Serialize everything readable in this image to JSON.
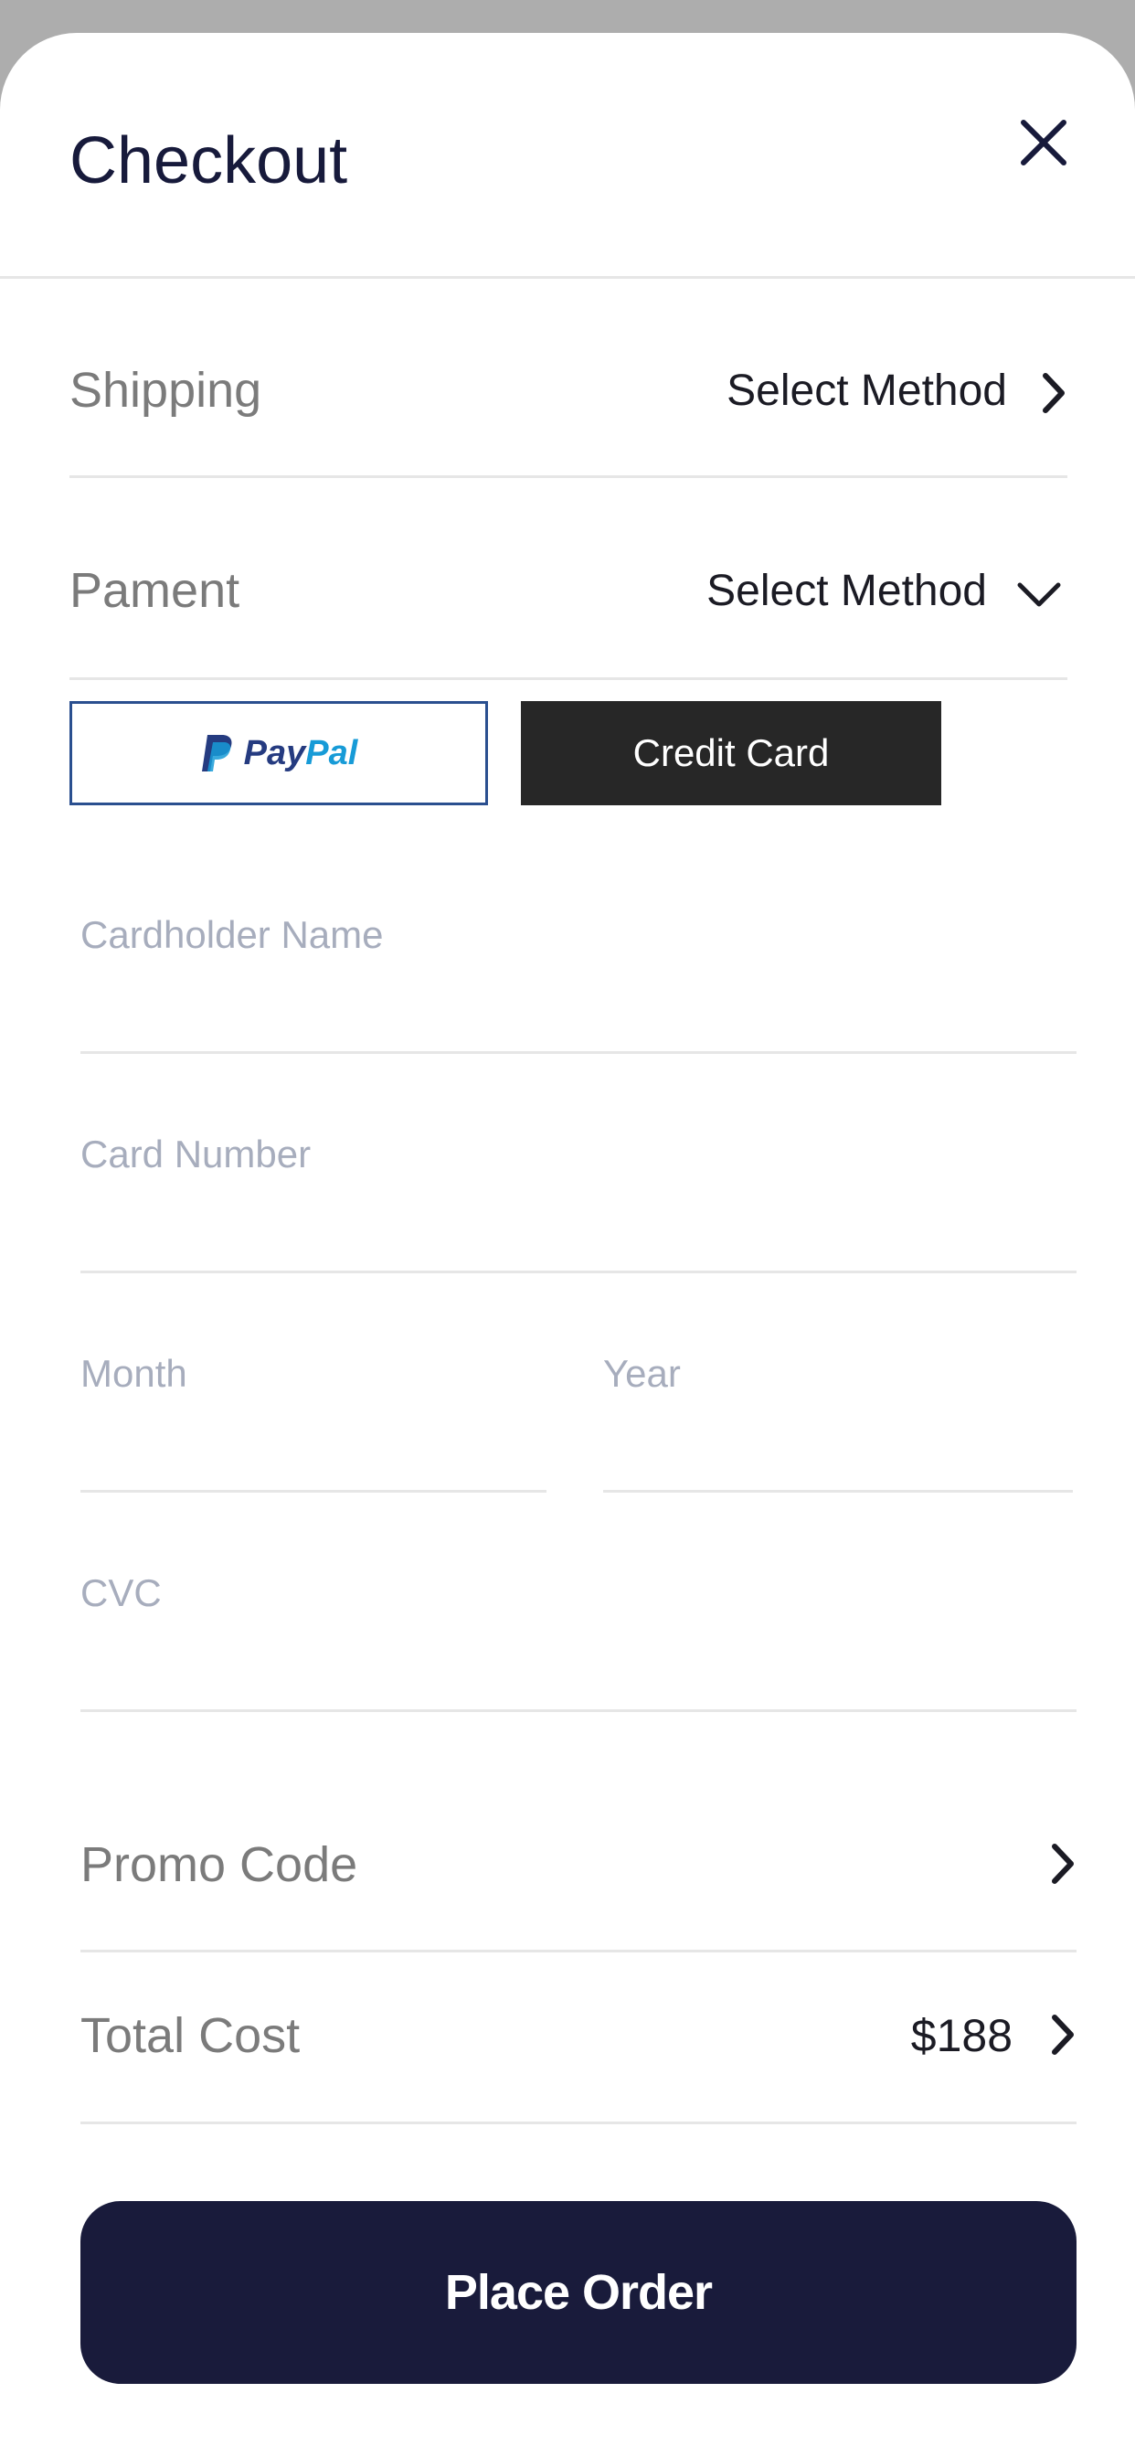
{
  "header": {
    "title": "Checkout"
  },
  "shipping": {
    "label": "Shipping",
    "value": "Select Method"
  },
  "payment": {
    "label": "Pament",
    "value": "Select Method"
  },
  "payment_options": {
    "paypal_part1": "Pay",
    "paypal_part2": "Pal",
    "credit_card": "Credit Card"
  },
  "form": {
    "cardholder_name": {
      "placeholder": "Cardholder Name",
      "value": ""
    },
    "card_number": {
      "placeholder": "Card Number",
      "value": ""
    },
    "month": {
      "placeholder": "Month",
      "value": ""
    },
    "year": {
      "placeholder": "Year",
      "value": ""
    },
    "cvc": {
      "placeholder": "CVC",
      "value": ""
    }
  },
  "promo": {
    "label": "Promo Code"
  },
  "total": {
    "label": "Total Cost",
    "value": "$188"
  },
  "actions": {
    "place_order": "Place Order"
  },
  "colors": {
    "primary": "#191b3b",
    "credit_card_bg": "#272727",
    "paypal_dark": "#253b80",
    "paypal_light": "#179bd7",
    "muted_text": "#7b7b7b",
    "placeholder": "#a7adbd"
  },
  "icons": {
    "close": "close-icon",
    "chevron_right": "chevron-right-icon",
    "chevron_down": "chevron-down-icon",
    "paypal_logo": "paypal-logo-icon"
  }
}
